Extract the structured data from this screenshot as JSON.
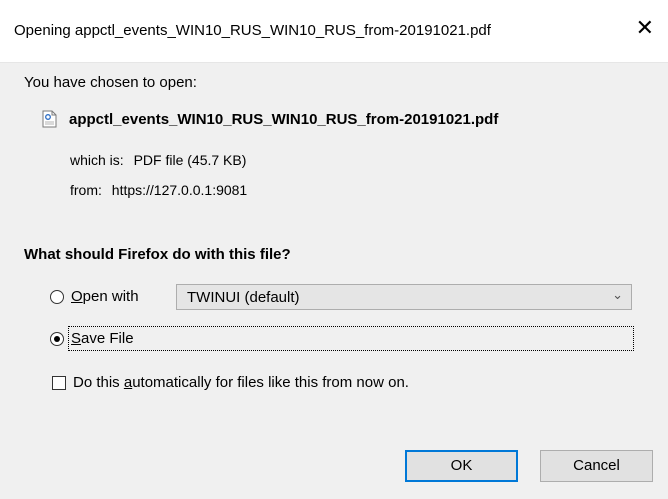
{
  "window": {
    "title": "Opening appctl_events_WIN10_RUS_WIN10_RUS_from-20191021.pdf",
    "close_symbol": "✕"
  },
  "intro": {
    "label": "You have chosen to open:"
  },
  "file": {
    "icon": "pdf-file-icon",
    "name": "appctl_events_WIN10_RUS_WIN10_RUS_from-20191021.pdf",
    "type_label": "which is:",
    "type_value": "PDF file (45.7 KB)",
    "from_label": "from:",
    "from_value": "https://127.0.0.1:9081"
  },
  "question": "What should Firefox do with this file?",
  "options": {
    "open_with": {
      "label_accel": "O",
      "label_rest": "pen with",
      "selected": false,
      "app_value": "TWINUI (default)"
    },
    "save_file": {
      "label_accel": "S",
      "label_rest": "ave File",
      "selected": true
    }
  },
  "auto": {
    "label_pre": "Do this ",
    "label_accel": "a",
    "label_post": "utomatically for files like this from now on.",
    "checked": false
  },
  "buttons": {
    "ok": "OK",
    "cancel": "Cancel"
  },
  "colors": {
    "dialog_bg": "#f0f0f0",
    "accent": "#0078d7"
  }
}
